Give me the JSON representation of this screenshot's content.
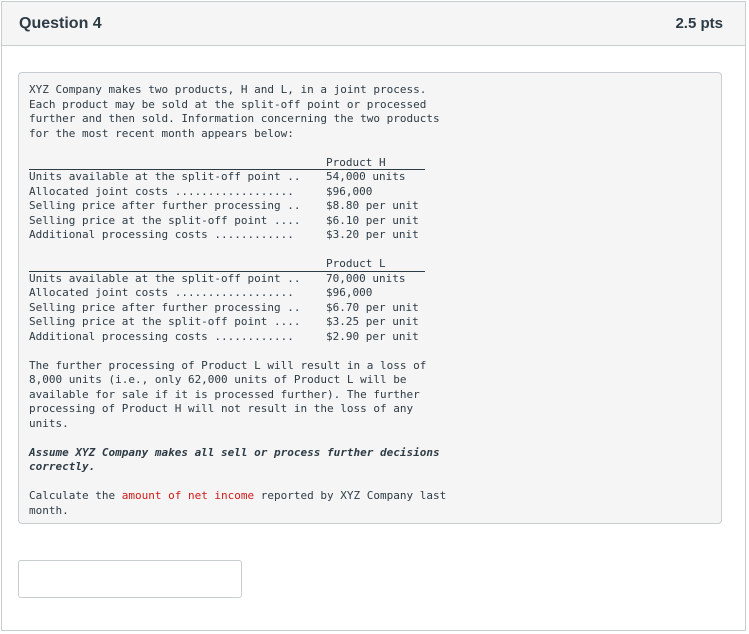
{
  "header": {
    "title": "Question 4",
    "points": "2.5 pts"
  },
  "intro": [
    "XYZ Company makes two products, H and L, in a joint process.",
    "Each product may be sold at the split-off point or processed",
    "further and then sold. Information concerning the two products",
    "for the most recent month appears below:"
  ],
  "product_h": {
    "heading": "Product H",
    "rows": [
      {
        "label": "Units available at the split-off point ..",
        "value": "54,000 units"
      },
      {
        "label": "Allocated joint costs ..................",
        "value": "$96,000"
      },
      {
        "label": "Selling price after further processing ..",
        "value": "$8.80 per unit"
      },
      {
        "label": "Selling price at the split-off point ....",
        "value": "$6.10 per unit"
      },
      {
        "label": "Additional processing costs ............",
        "value": "$3.20 per unit"
      }
    ]
  },
  "product_l": {
    "heading": "Product L",
    "rows": [
      {
        "label": "Units available at the split-off point ..",
        "value": "70,000 units"
      },
      {
        "label": "Allocated joint costs ..................",
        "value": "$96,000"
      },
      {
        "label": "Selling price after further processing ..",
        "value": "$6.70 per unit"
      },
      {
        "label": "Selling price at the split-off point ....",
        "value": "$3.25 per unit"
      },
      {
        "label": "Additional processing costs ............",
        "value": "$2.90 per unit"
      }
    ]
  },
  "loss_note": [
    "The further processing of Product L will result in a loss of",
    "8,000 units (i.e., only 62,000 units of Product L will be",
    "available for sale if it is processed further). The further",
    "processing of Product H will not result in the loss of any",
    "units."
  ],
  "assumption": [
    "Assume XYZ Company makes all sell or process further decisions",
    "correctly."
  ],
  "task": {
    "prefix": "Calculate the ",
    "highlight": "amount of net income",
    "suffix": " reported by XYZ Company last",
    "line2": "month."
  },
  "answer": {
    "value": ""
  }
}
